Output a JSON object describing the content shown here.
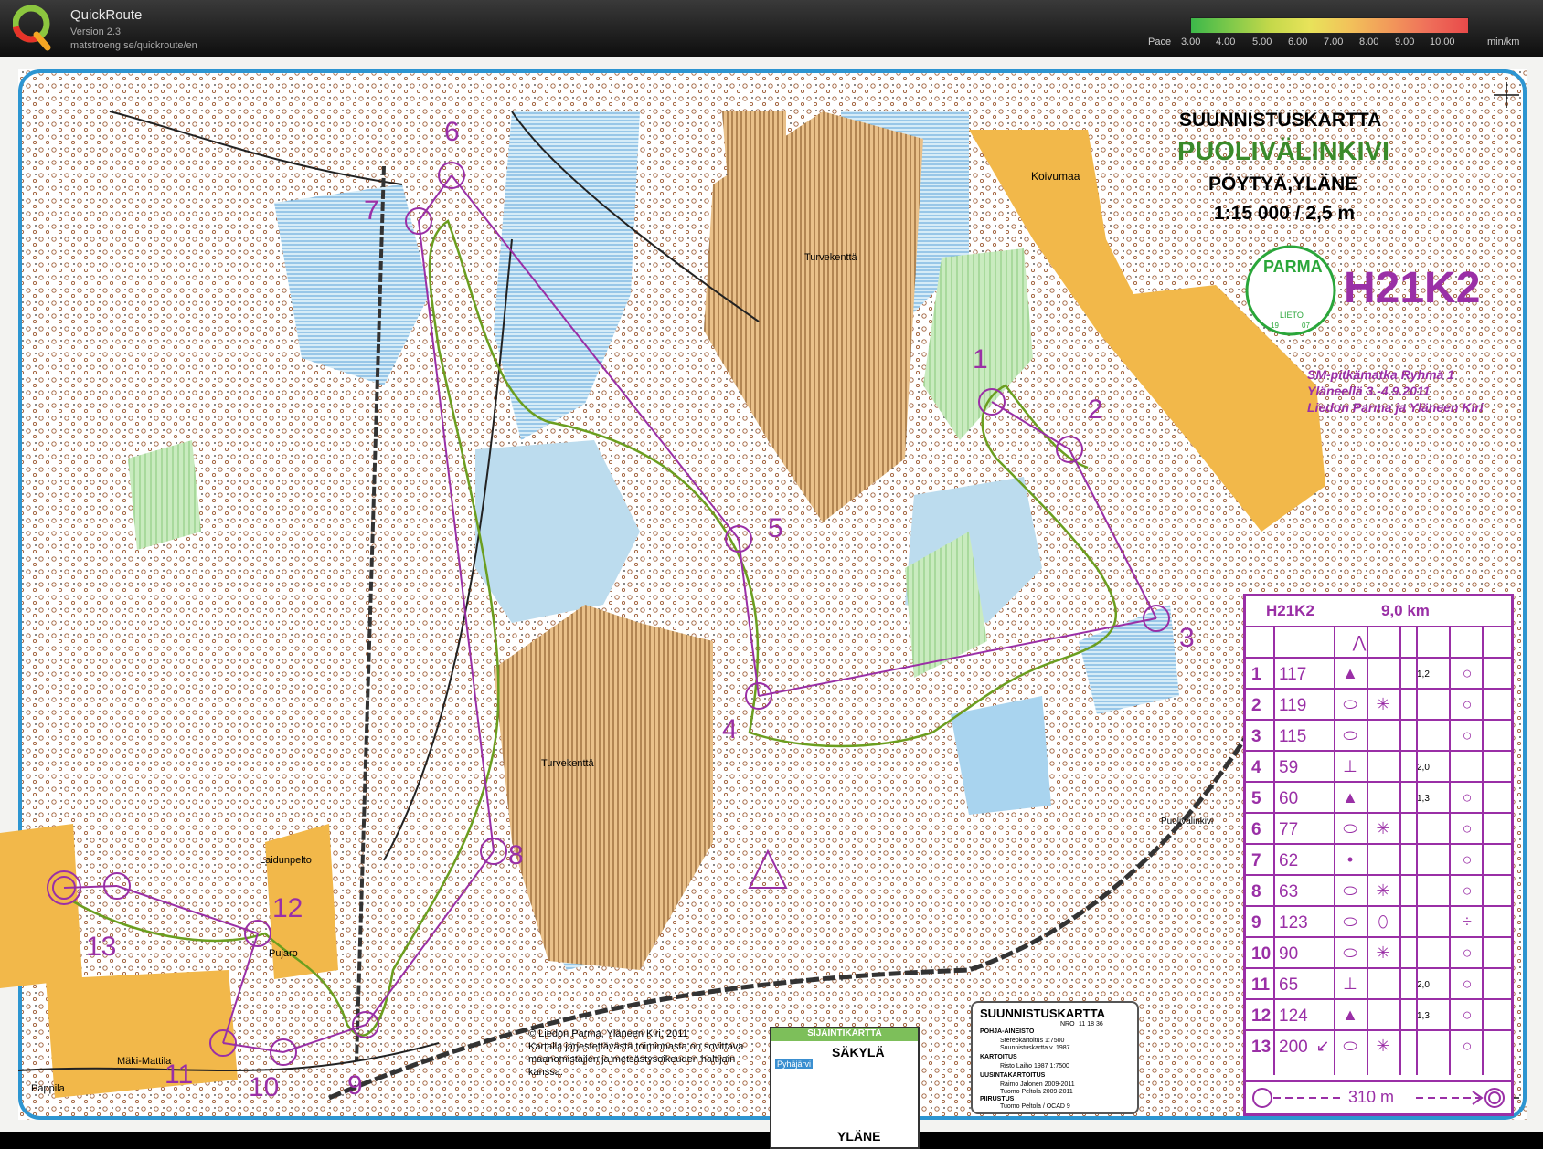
{
  "app": {
    "title": "QuickRoute",
    "version": "Version 2.3",
    "url": "matstroeng.se/quickroute/en"
  },
  "pace_scale": {
    "label": "Pace",
    "ticks": [
      "3.00",
      "4.00",
      "5.00",
      "6.00",
      "7.00",
      "8.00",
      "9.00",
      "10.00"
    ],
    "unit": "min/km",
    "colors": [
      "#3cb84a",
      "#7fc94a",
      "#c4d84a",
      "#e8e35a",
      "#f2c25a",
      "#f29a5a",
      "#ef6f5a",
      "#e84a4a"
    ]
  },
  "map": {
    "header": {
      "line1": "SUUNNISTUSKARTTA",
      "name": "PUOLIVÄLINKIVI",
      "place": "PÖYTYÄ,YLÄNE",
      "scale": "1:15 000 / 2,5 m"
    },
    "club_logo": {
      "text": "PARMA",
      "town": "LIETO",
      "year_left": "19",
      "year_right": "07"
    },
    "course_code": "H21K2",
    "event": {
      "line1": "SM-pitkämatka Ryhmä 1",
      "line2": "Yläneellä 3.-4.9.2011",
      "line3": "Liedon Parma ja Yläneen Kiri"
    },
    "place_names": [
      "Koivumaa",
      "Turvekenttä",
      "Turvekenttä",
      "Laidunpelto",
      "Pujaro",
      "Mäki-Mattila",
      "Pappila",
      "Puolivälinkivi"
    ],
    "control_labels": [
      "1",
      "2",
      "3",
      "4",
      "5",
      "6",
      "7",
      "8",
      "9",
      "10",
      "11",
      "12",
      "13"
    ],
    "copyright": {
      "line1": "© Liedon Parma, Yläneen Kiri, 2011",
      "line2": "Kartalla järjestettävästä toiminnasta on sovittava",
      "line3": "maanomistajien ja metsästysoikeuden haltijain",
      "line4": "kanssa."
    },
    "locator_map": {
      "title": "SIJAINTIKARTTA",
      "town1": "SÄKYLÄ",
      "town2": "YLÄNE",
      "lake": "Pyhäjärvi"
    },
    "legend_box": {
      "title": "SUUNNISTUSKARTTA",
      "nro_label": "NRO",
      "nro": "11 18 36",
      "base_label": "POHJA-AINEISTO",
      "base1": "Stereokartoitus 1:7500",
      "base2": "Suunnistuskartta v. 1987",
      "survey_label": "KARTOITUS",
      "survey": "Risto Laiho 1987 1:7500",
      "update_label": "UUSINTAKARTOITUS",
      "update1": "Raimo Jalonen 2009-2011",
      "update2": "Tuomo Peltola 2009-2011",
      "draw_label": "PIIRUSTUS",
      "draw": "Tuomo Peltola / OCAD 9"
    }
  },
  "description_sheet": {
    "course": "H21K2",
    "length": "9,0 km",
    "rows": [
      {
        "num": "1",
        "code": "117",
        "dim": "1,2"
      },
      {
        "num": "2",
        "code": "119",
        "dim": ""
      },
      {
        "num": "3",
        "code": "115",
        "dim": ""
      },
      {
        "num": "4",
        "code": "59",
        "dim": "2,0"
      },
      {
        "num": "5",
        "code": "60",
        "dim": "1,3"
      },
      {
        "num": "6",
        "code": "77",
        "dim": ""
      },
      {
        "num": "7",
        "code": "62",
        "dim": ""
      },
      {
        "num": "8",
        "code": "63",
        "dim": ""
      },
      {
        "num": "9",
        "code": "123",
        "dim": ""
      },
      {
        "num": "10",
        "code": "90",
        "dim": ""
      },
      {
        "num": "11",
        "code": "65",
        "dim": "2,0"
      },
      {
        "num": "12",
        "code": "124",
        "dim": "1,3"
      },
      {
        "num": "13",
        "code": "200",
        "dim": ""
      }
    ],
    "finish_distance": "310 m"
  }
}
